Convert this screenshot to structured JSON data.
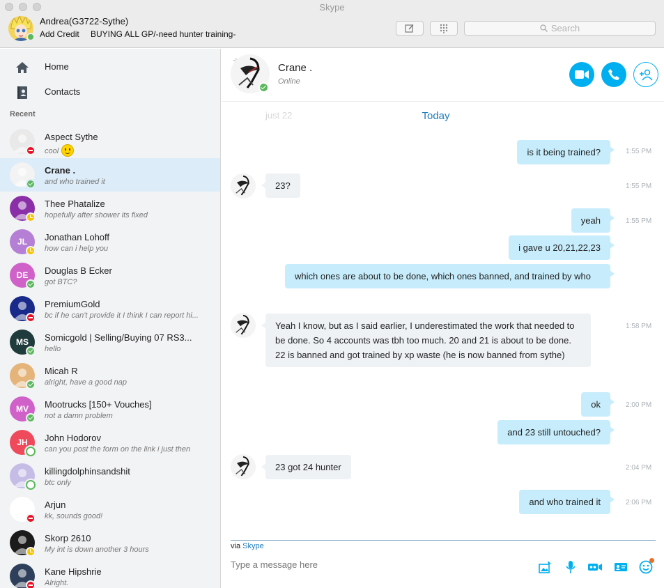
{
  "window": {
    "title": "Skype"
  },
  "profile": {
    "name": "Andrea(G3722-Sythe)",
    "add_credit": "Add Credit",
    "mood": "BUYING ALL GP/-need hunter training-",
    "status": "online"
  },
  "search": {
    "placeholder": "Search"
  },
  "sidebar": {
    "nav": [
      {
        "label": "Home",
        "icon": "home-icon"
      },
      {
        "label": "Contacts",
        "icon": "contacts-icon"
      }
    ],
    "recent_label": "Recent",
    "contacts": [
      {
        "name": "Aspect Sythe",
        "message": "cool",
        "status": "dnd",
        "avatar_color": "#e9e9e9",
        "initials": "",
        "emoticon": "smile"
      },
      {
        "name": "Crane .",
        "message": "and who trained it",
        "status": "online",
        "avatar_color": "#f3f3f3",
        "initials": "",
        "active": true
      },
      {
        "name": "Thee Phatalize",
        "message": "hopefully after shower its fixed",
        "status": "away",
        "avatar_color": "#8b2fa8",
        "initials": ""
      },
      {
        "name": "Jonathan Lohoff",
        "message": "how can i help you",
        "status": "away",
        "avatar_color": "#b57fd6",
        "initials": "JL"
      },
      {
        "name": "Douglas B Ecker",
        "message": "got BTC?",
        "status": "online",
        "avatar_color": "#d061c8",
        "initials": "DE"
      },
      {
        "name": "PremiumGold",
        "message": "bc if he can't provide it I think I can report hi...",
        "status": "dnd",
        "avatar_color": "#1a2a8a",
        "initials": ""
      },
      {
        "name": "Somicgold  | Selling/Buying 07 RS3...",
        "message": "hello",
        "status": "online",
        "avatar_color": "#1f3b3b",
        "initials": "MS"
      },
      {
        "name": "Micah R",
        "message": "alright, have a good nap",
        "status": "online",
        "avatar_color": "#e5b47a",
        "initials": ""
      },
      {
        "name": "Mootrucks [150+ Vouches]",
        "message": "not a damn problem",
        "status": "online",
        "avatar_color": "#d061c8",
        "initials": "MV"
      },
      {
        "name": "John Hodorov",
        "message": "can you post the form on the link i just then",
        "status": "offline",
        "avatar_color": "#ef4a5c",
        "initials": "JH"
      },
      {
        "name": "killingdolphinsandshit",
        "message": "btc only",
        "status": "offline",
        "avatar_color": "#c6bde6",
        "initials": ""
      },
      {
        "name": "Arjun",
        "message": "kk, sounds good!",
        "status": "dnd",
        "avatar_color": "#ffffff",
        "initials": ""
      },
      {
        "name": "Skorp 2610",
        "message": "My int is down another 3 hours",
        "status": "away",
        "avatar_color": "#1b1b1b",
        "initials": ""
      },
      {
        "name": "Kane Hipshrie",
        "message": "Alright.",
        "status": "dnd",
        "avatar_color": "#2d3f5a",
        "initials": ""
      }
    ]
  },
  "chat": {
    "contact_name": "Crane .",
    "contact_status": "Online",
    "ghost_text": "just 22",
    "date_divider": "Today",
    "messages": [
      {
        "dir": "out",
        "text": "is it being trained?",
        "time": "1:55 PM"
      },
      {
        "dir": "in",
        "text": "23?",
        "time": "1:55 PM"
      },
      {
        "dir": "out",
        "text": "yeah",
        "time": "1:55 PM"
      },
      {
        "dir": "out",
        "text": "i gave u 20,21,22,23",
        "time": ""
      },
      {
        "dir": "out",
        "text": "which ones are about to be done, which ones banned, and trained by who",
        "time": ""
      },
      {
        "dir": "in",
        "text": "Yeah I know, but as I said earlier, I underestimated the work that needed to be done. So 4 accounts was tbh too much. 20 and 21 is about to be done. 22 is banned and got trained by xp waste (he is now banned from sythe)",
        "time": "1:58 PM"
      },
      {
        "dir": "out",
        "text": "ok",
        "time": "2:00 PM"
      },
      {
        "dir": "out",
        "text": "and 23 still untouched?",
        "time": ""
      },
      {
        "dir": "in",
        "text": "23 got 24 hunter",
        "time": "2:04 PM"
      },
      {
        "dir": "out",
        "text": "and who trained it",
        "time": "2:06 PM"
      }
    ]
  },
  "composer": {
    "via_prefix": "via",
    "via_link": "Skype",
    "placeholder": "Type a message here"
  },
  "colors": {
    "accent": "#00aff0",
    "outgoing_bubble": "#c7edfc",
    "incoming_bubble": "#eef2f5",
    "link": "#1c7bbd"
  }
}
